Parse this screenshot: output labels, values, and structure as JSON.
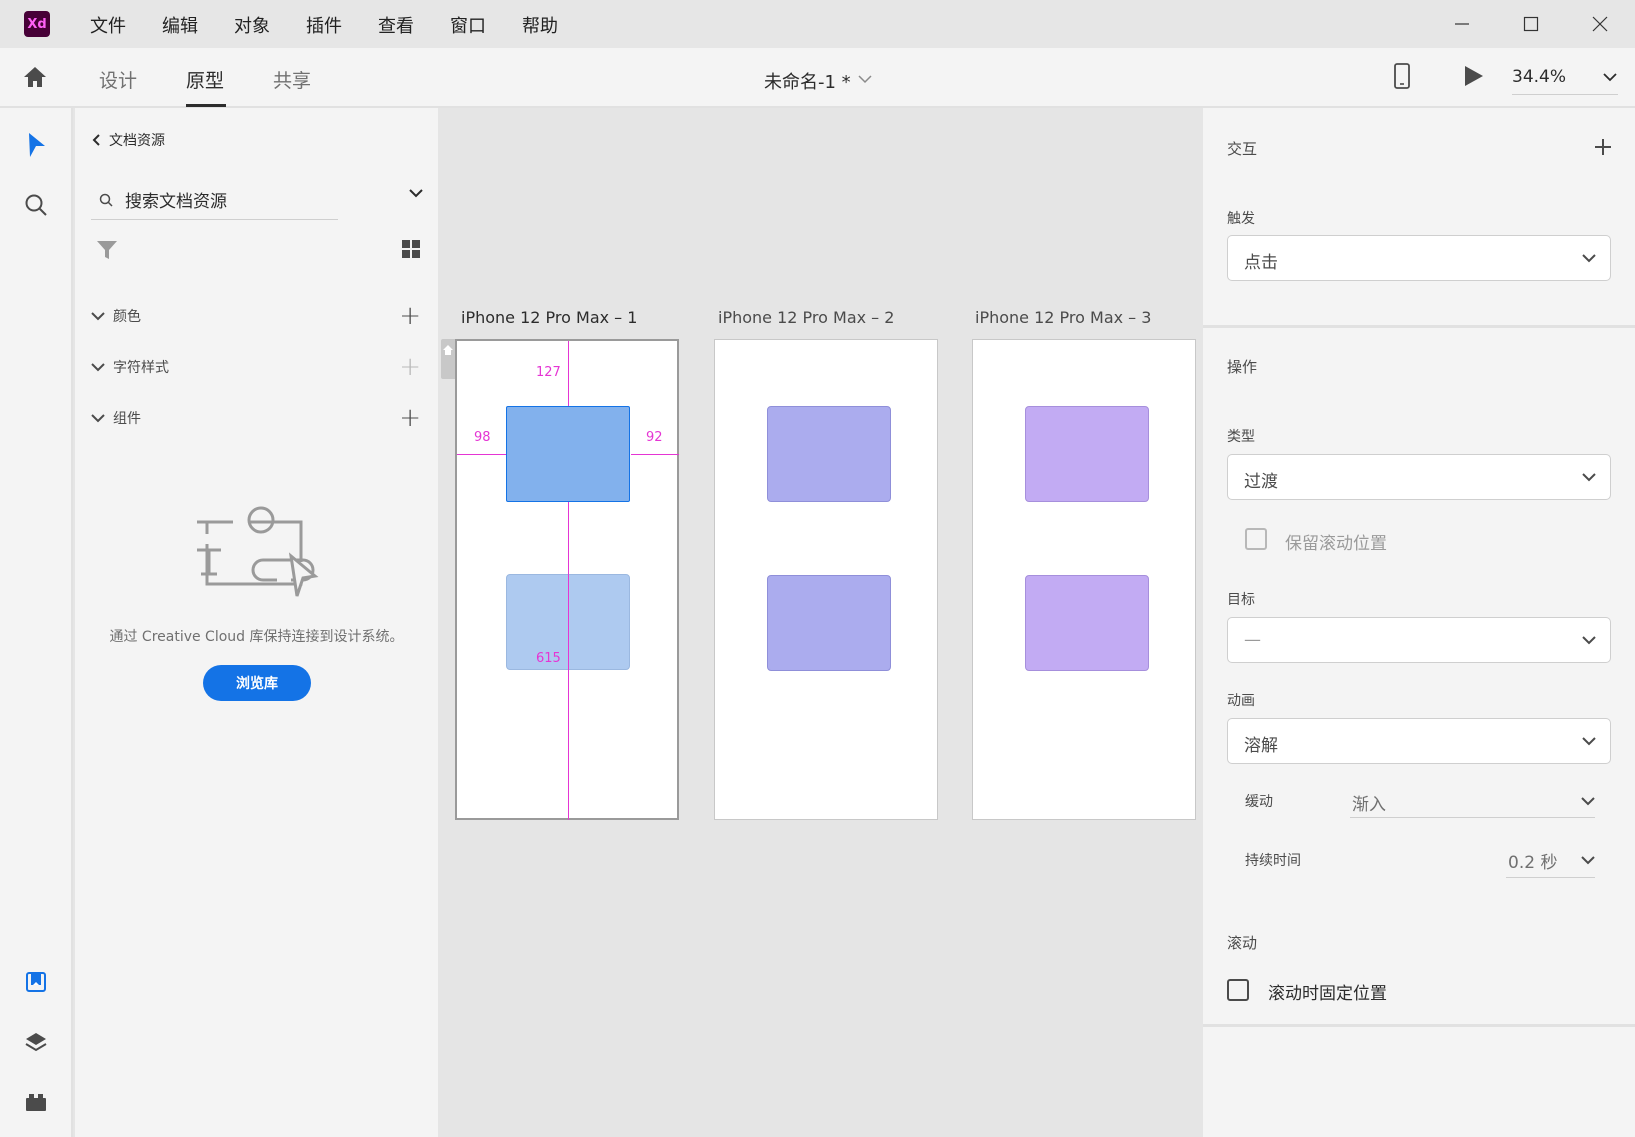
{
  "app": {
    "logo_text": "Xd"
  },
  "menu": [
    "文件",
    "编辑",
    "对象",
    "插件",
    "查看",
    "窗口",
    "帮助"
  ],
  "toolbar": {
    "tabs": [
      "设计",
      "原型",
      "共享"
    ],
    "active_tab": "原型",
    "doc_title": "未命名-1 *",
    "zoom": "34.4%"
  },
  "assets": {
    "back_label": "文档资源",
    "search_placeholder": "搜索文档资源",
    "sections": [
      {
        "label": "颜色",
        "add_enabled": true
      },
      {
        "label": "字符样式",
        "add_enabled": false
      },
      {
        "label": "组件",
        "add_enabled": true
      }
    ],
    "empty_message": "通过 Creative Cloud 库保持连接到设计系统。",
    "browse_button": "浏览库"
  },
  "canvas": {
    "artboards": [
      {
        "label": "iPhone 12 Pro Max – 1",
        "selected": true
      },
      {
        "label": "iPhone 12 Pro Max – 2",
        "selected": false
      },
      {
        "label": "iPhone 12 Pro Max – 3",
        "selected": false
      }
    ],
    "measurements": {
      "top": "127",
      "left": "98",
      "right": "92",
      "bottom": "615"
    },
    "colors": {
      "selected_rect": "#82b1ed",
      "ghost_rect": "#aecaf0",
      "periwinkle": "#abacee",
      "lavender": "#c2abf3",
      "guide": "#e535d4"
    }
  },
  "inspector": {
    "interaction_heading": "交互",
    "trigger_label": "触发",
    "trigger_value": "点击",
    "action_heading": "操作",
    "type_label": "类型",
    "type_value": "过渡",
    "preserve_scroll_label": "保留滚动位置",
    "target_label": "目标",
    "target_value": "—",
    "animation_label": "动画",
    "animation_value": "溶解",
    "easing_label": "缓动",
    "easing_value": "渐入",
    "duration_label": "持续时间",
    "duration_value": "0.2 秒",
    "scroll_heading": "滚动",
    "fix_position_label": "滚动时固定位置"
  }
}
